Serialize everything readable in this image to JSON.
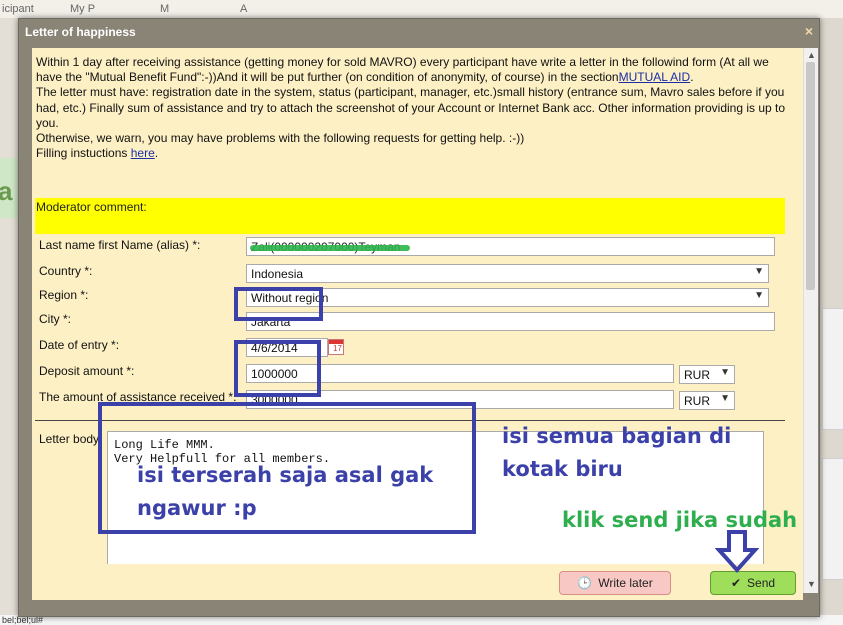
{
  "background": {
    "tab_left": "icipant",
    "tab_mid1": "My P",
    "tab_mid2": "M",
    "tab_mid3": "A",
    "bottom_text": "bel;bel;ul#"
  },
  "dialog": {
    "title": "Letter of happiness",
    "close_glyph": "×"
  },
  "intro": {
    "line1": "Within 1 day after receiving assistance (getting money for sold MAVRO) every participant have write a letter in the followind form (At all we have the \"Mutual Benefit Fund\":-))And it will be put further (on condition of anonymity, of course) in the section",
    "link1": "MUTUAL AID",
    "line1_end": ".",
    "line2": "The letter must have: registration date in the system, status (participant, manager, etc.)small history (entrance sum, Mavro sales before if you had, etc.) Finally sum of assistance and try to attach the screenshot of your Account or Internet Bank acc. Other information providing is up to you.",
    "line3": "Otherwise, we warn, you may have problems with the following requests for getting help. :-))",
    "line4": "Filling instuctions ",
    "link2": "here",
    "line4_end": "."
  },
  "moderator": {
    "label": "Moderator comment:"
  },
  "form": {
    "name_label": "Last name first Name (alias) *:",
    "name_value": "Zali(000000207000)Teyman",
    "country_label": "Country *:",
    "country_value": "Indonesia",
    "region_label": "Region *:",
    "region_value": "Without region",
    "city_label": "City *:",
    "city_value": "Jakarta",
    "date_label": "Date of entry *:",
    "date_value": "4/6/2014",
    "calendar_day": "17",
    "deposit_label": "Deposit amount *:",
    "deposit_value": "1000000",
    "deposit_currency": "RUR",
    "assist_label": "The amount of assistance received *:",
    "assist_value": "3000000",
    "assist_currency": "RUR",
    "letter_label": "Letter body",
    "letter_value": "Long Life MMM.\nVery Helpfull for all members."
  },
  "buttons": {
    "write_later": "Write later",
    "send": "Send"
  },
  "annotations": {
    "fill_box_1": "isi semua bagian di",
    "fill_box_2": "kotak biru",
    "letter_hint_1": "isi terserah saja asal gak",
    "letter_hint_2": "ngawur :p",
    "send_hint": "klik send jika sudah"
  },
  "colors": {
    "annotation_blue": "#3b41a8",
    "annotation_green": "#2fae4e",
    "panel_bg": "#fdf0c5",
    "moderator_bg": "#ffff00",
    "send_button": "#9fde5a",
    "later_button": "#f7c8c4"
  }
}
